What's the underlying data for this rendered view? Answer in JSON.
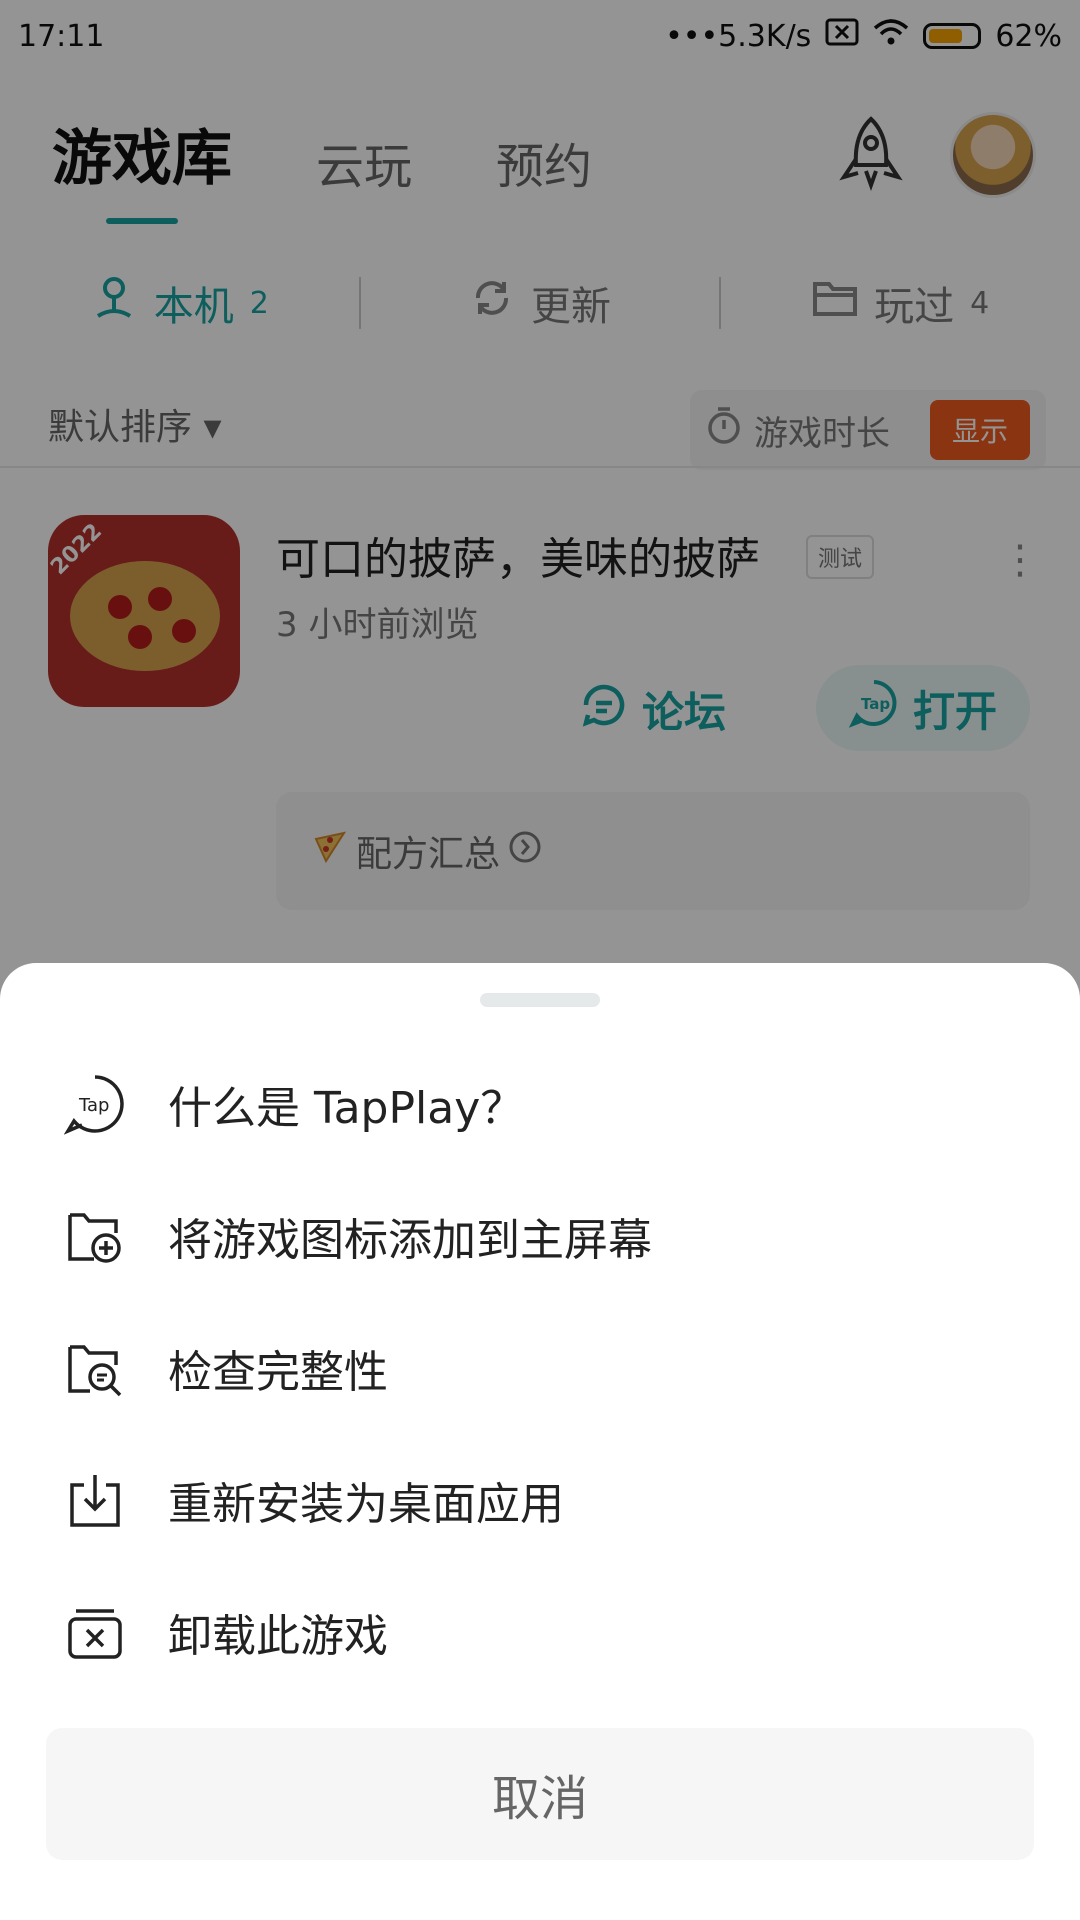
{
  "status_bar": {
    "time": "17:11",
    "speed": "•••5.3K/s",
    "battery_percent": "62%",
    "battery_level": 0.62
  },
  "top_tabs": [
    {
      "label": "游戏库",
      "active": true
    },
    {
      "label": "云玩",
      "active": false
    },
    {
      "label": "预约",
      "active": false
    }
  ],
  "sub_tabs": {
    "local": {
      "label": "本机",
      "count": "2"
    },
    "update": {
      "label": "更新"
    },
    "played": {
      "label": "玩过",
      "count": "4"
    }
  },
  "sort": {
    "label": "默认排序 ▾"
  },
  "playtime": {
    "label": "游戏时长",
    "toggle_label": "显示"
  },
  "game": {
    "title": "可口的披萨，美味的披萨",
    "badge": "测试",
    "subtitle": "3 小时前浏览",
    "forum_label": "论坛",
    "open_label": "打开",
    "recipe_label": "配方汇总",
    "icon_badge": "2022"
  },
  "sheet": {
    "items": [
      {
        "label": "什么是 TapPlay？",
        "icon": "tap-logo-icon"
      },
      {
        "label": "将游戏图标添加到主屏幕",
        "icon": "add-to-home-icon"
      },
      {
        "label": "检查完整性",
        "icon": "check-integrity-icon"
      },
      {
        "label": "重新安装为桌面应用",
        "icon": "download-install-icon"
      },
      {
        "label": "卸载此游戏",
        "icon": "uninstall-icon"
      }
    ],
    "cancel_label": "取消"
  },
  "colors": {
    "accent": "#17a2a0",
    "toggle": "#f05a1e"
  }
}
